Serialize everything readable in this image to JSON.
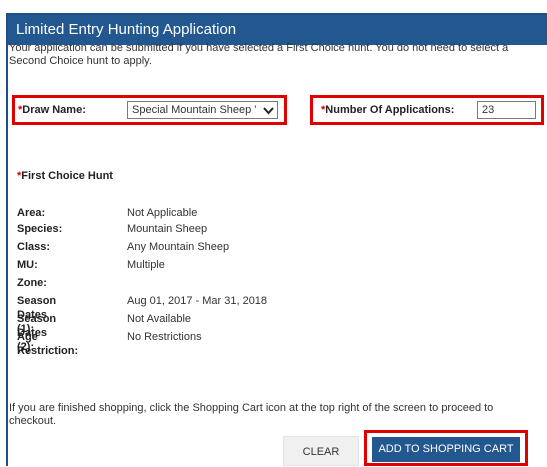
{
  "header": {
    "title": "Limited Entry Hunting Application"
  },
  "intro_text": "Your application can be submitted if you have selected a First Choice hunt. You do not need to select a Second Choice hunt to apply.",
  "required_marker": "*",
  "draw_name": {
    "label": "Draw Name:",
    "value": "Special Mountain Sheep '",
    "icon": "chevron-down-icon"
  },
  "num_applications": {
    "label": "Number Of Applications:",
    "value": "23"
  },
  "first_choice": {
    "title": "First Choice Hunt",
    "details": [
      {
        "key": "Area:",
        "value": "Not Applicable"
      },
      {
        "key": "Species:",
        "value": "Mountain Sheep"
      },
      {
        "key": "Class:",
        "value": "Any Mountain Sheep"
      },
      {
        "key": "MU:",
        "value": "Multiple"
      },
      {
        "key": "Zone:",
        "value": ""
      },
      {
        "key": "Season Dates (1):",
        "value": "Aug 01, 2017 - Mar 31, 2018"
      },
      {
        "key": "Season Dates (2):",
        "value": "Not Available"
      },
      {
        "key": "Age Restriction:",
        "value": "No Restrictions"
      }
    ]
  },
  "footer_text": "If you are finished shopping, click the Shopping Cart icon at the top right of the screen to proceed to checkout.",
  "buttons": {
    "clear": "CLEAR",
    "add_to_cart": "ADD TO SHOPPING CART"
  },
  "colors": {
    "header_bg": "#23578f",
    "required": "#d00000",
    "highlight": "#e00000",
    "primary_button": "#23578f"
  }
}
